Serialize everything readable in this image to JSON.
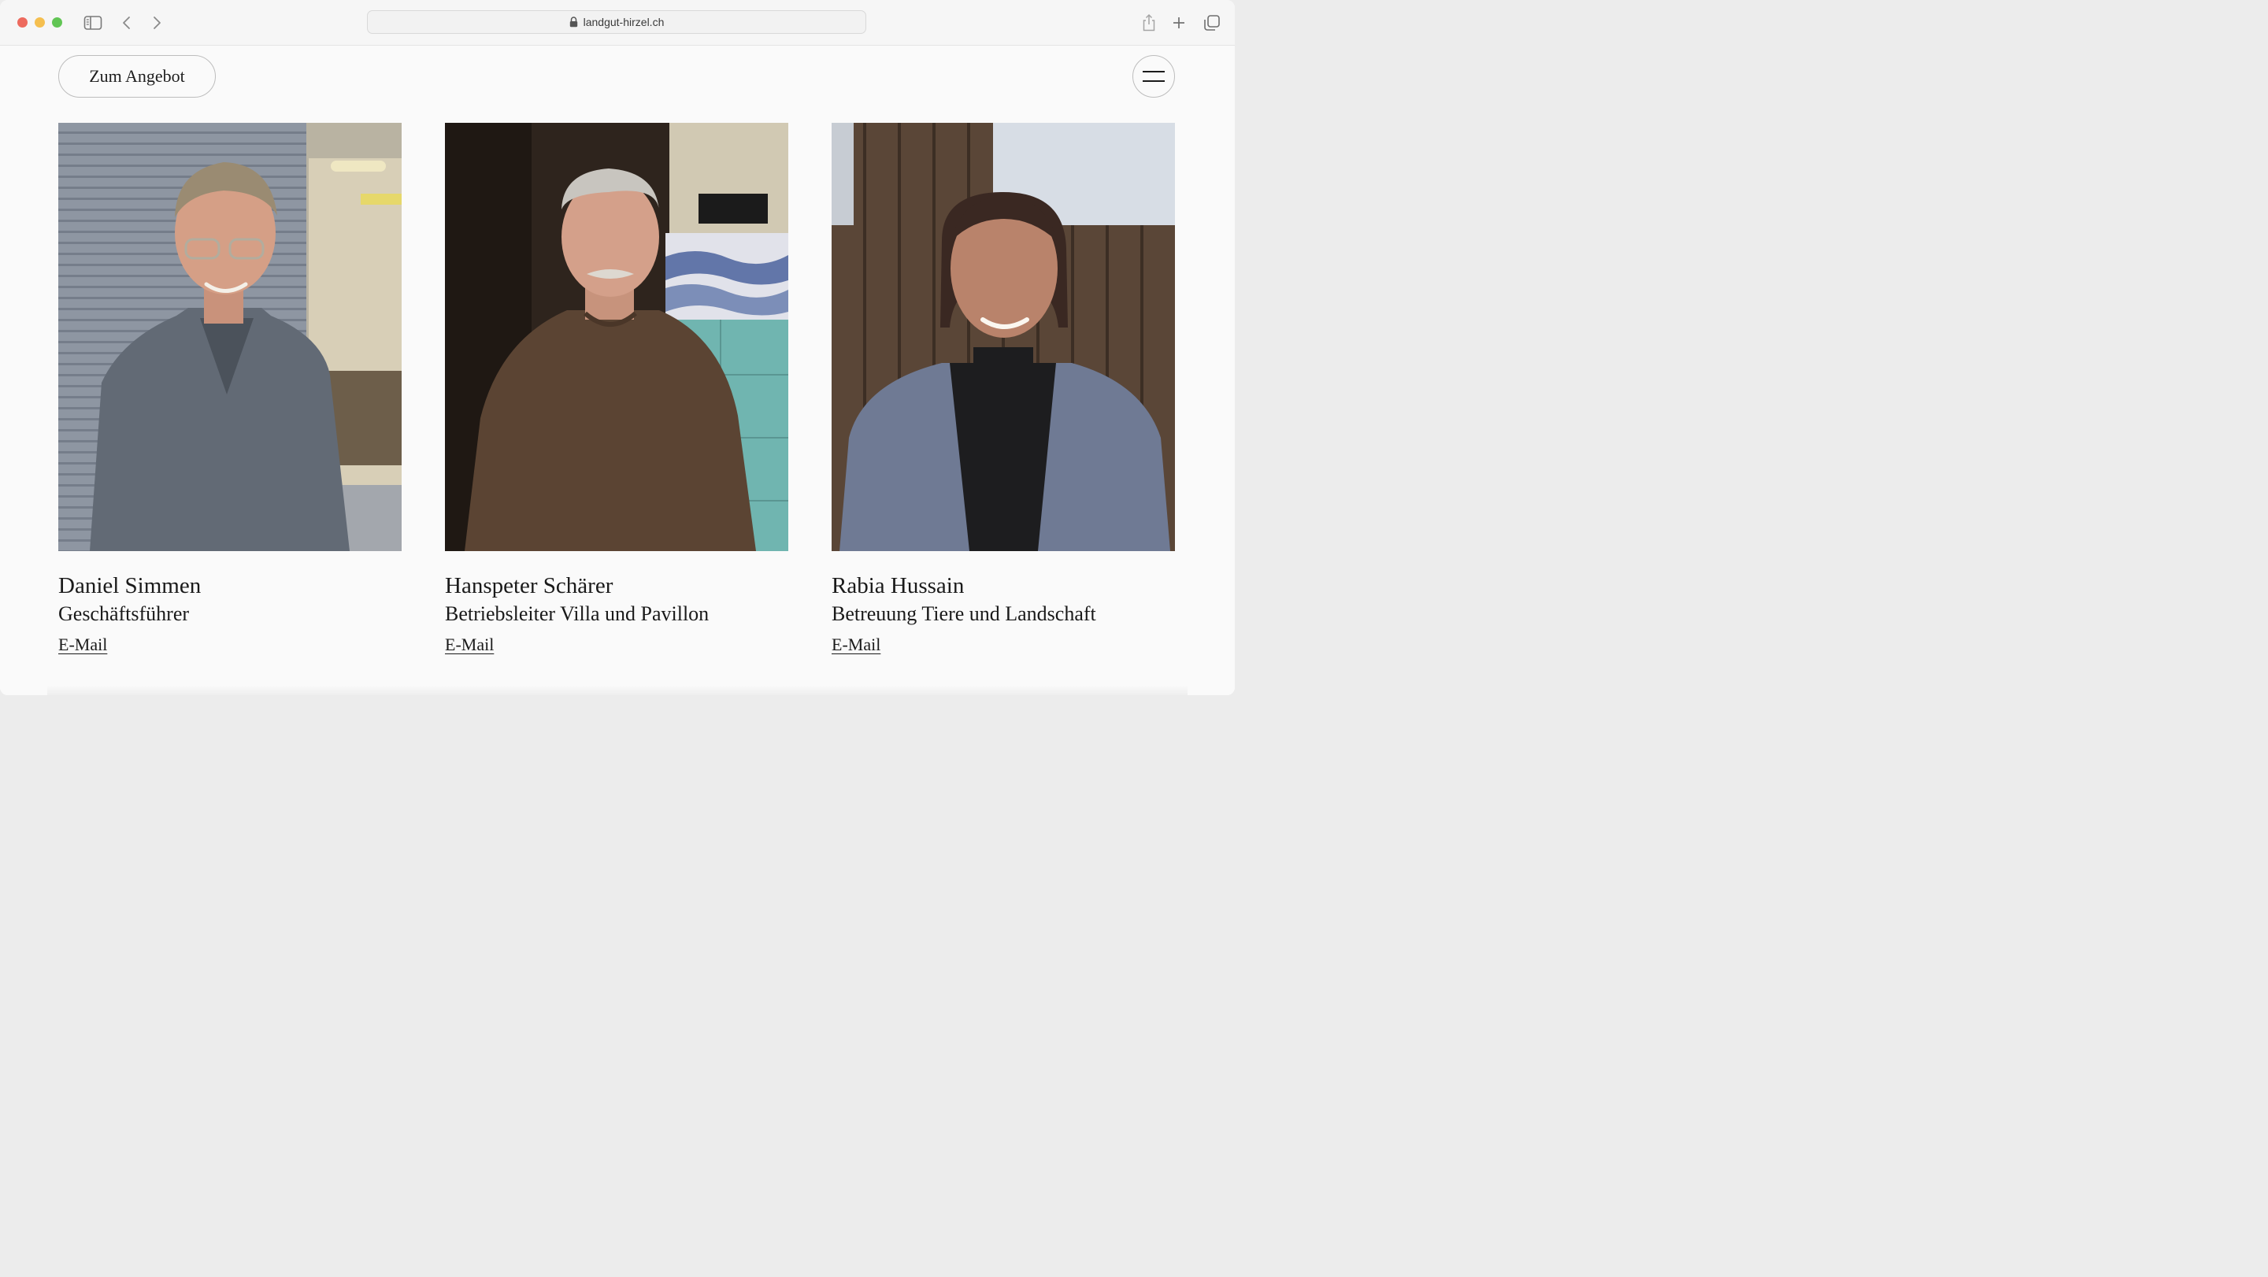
{
  "browser": {
    "url": "landgut-hirzel.ch"
  },
  "header": {
    "offer_button_label": "Zum Angebot",
    "menu_icon": "hamburger-icon"
  },
  "team": [
    {
      "name": "Daniel Simmen",
      "role": "Geschäftsführer",
      "email_label": "E-Mail"
    },
    {
      "name": "Hanspeter Schärer",
      "role": "Betriebsleiter Villa und Pavillon",
      "email_label": "E-Mail"
    },
    {
      "name": "Rabia Hussain",
      "role": "Betreuung Tiere und Landschaft",
      "email_label": "E-Mail"
    }
  ],
  "colors": {
    "page_background": "#fafafa",
    "text": "#1a1a1a",
    "button_border": "#bdbdbd"
  }
}
